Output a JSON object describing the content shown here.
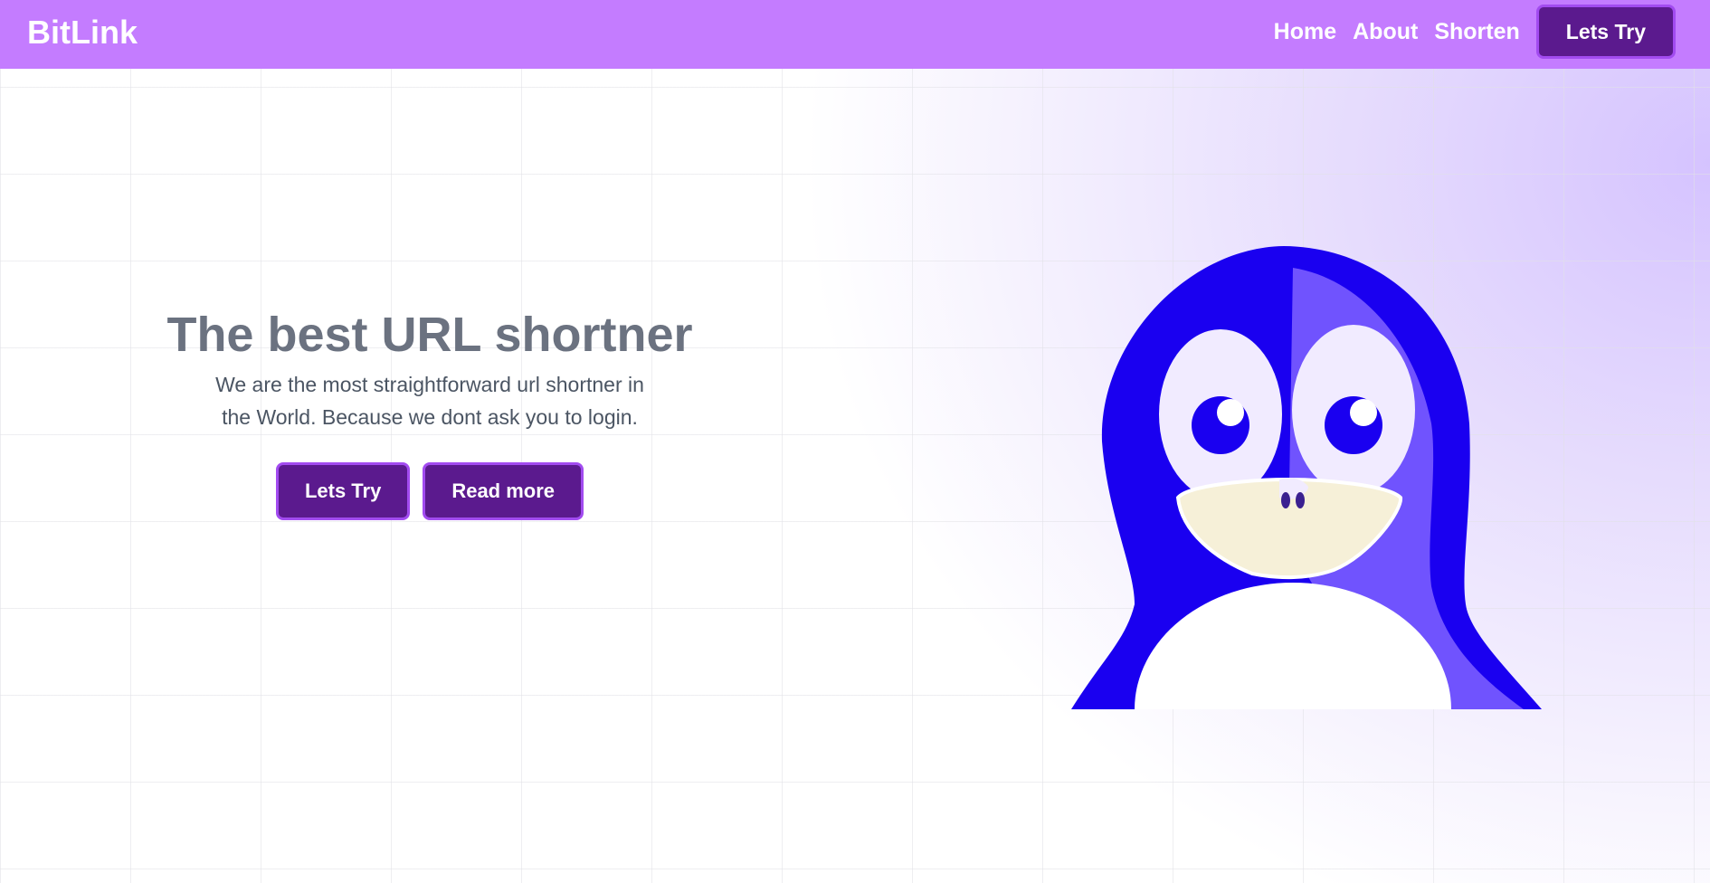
{
  "navbar": {
    "brand": "BitLink",
    "links": [
      "Home",
      "About",
      "Shorten"
    ],
    "cta_label": "Lets Try",
    "background_color": "#c47cff"
  },
  "hero": {
    "title": "The best URL shortner",
    "description": "We are the most straightforward url shortner in the World. Because we dont ask you to login.",
    "primary_button": "Lets Try",
    "secondary_button": "Read more"
  },
  "illustration": {
    "icon": "penguin-icon"
  },
  "colors": {
    "accent": "#5b1a8e",
    "accent_border": "#a24bf0",
    "penguin_blue": "#1a00f0"
  }
}
